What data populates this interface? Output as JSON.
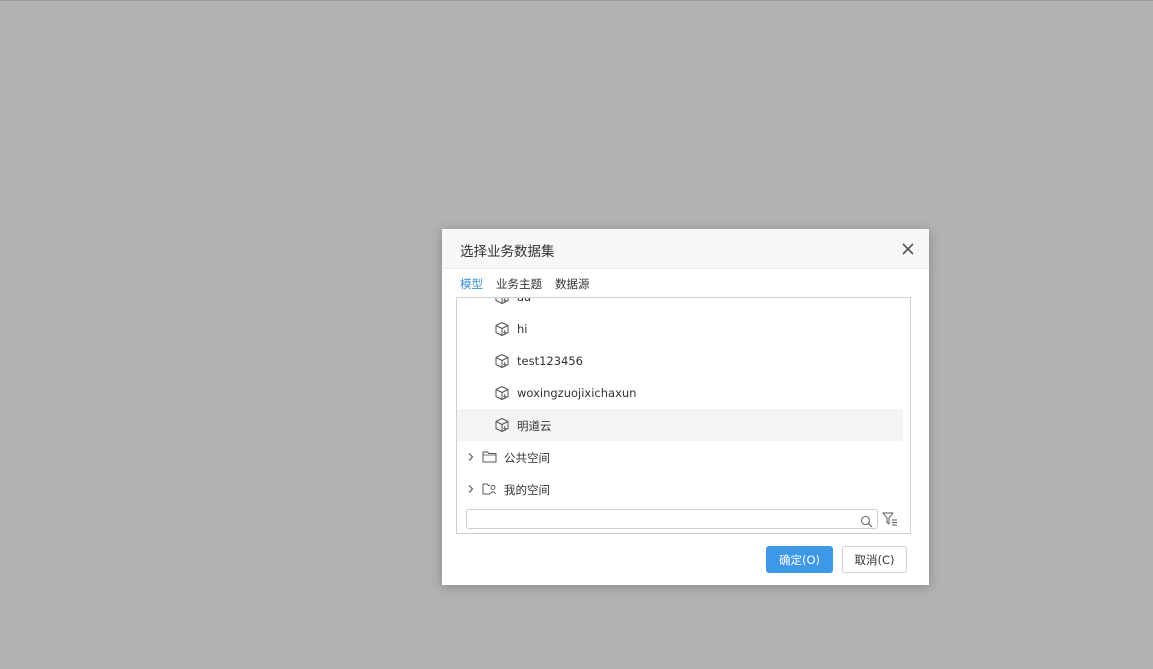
{
  "dialog": {
    "title": "选择业务数据集",
    "tabs": [
      {
        "label": "模型",
        "active": true
      },
      {
        "label": "业务主题",
        "active": false
      },
      {
        "label": "数据源",
        "active": false
      }
    ],
    "tree": {
      "leaf_items": [
        {
          "label": "aa",
          "icon": "model-cube-icon"
        },
        {
          "label": "hi",
          "icon": "model-cube-icon"
        },
        {
          "label": "test123456",
          "icon": "model-cube-icon"
        },
        {
          "label": "woxingzuojixichaxun",
          "icon": "model-cube-icon"
        },
        {
          "label": "明道云",
          "icon": "model-cube-icon",
          "selected": true
        }
      ],
      "folders": [
        {
          "label": "公共空间",
          "icon": "folder-icon"
        },
        {
          "label": "我的空间",
          "icon": "user-folder-icon"
        }
      ]
    },
    "search": {
      "value": "",
      "placeholder": ""
    },
    "buttons": {
      "ok": "确定(O)",
      "cancel": "取消(C)"
    }
  },
  "colors": {
    "overlay": "#b2b2b2",
    "accent": "#3d98e6",
    "tab_active": "#3d8fd9",
    "selected_row": "#f3f4f6"
  }
}
